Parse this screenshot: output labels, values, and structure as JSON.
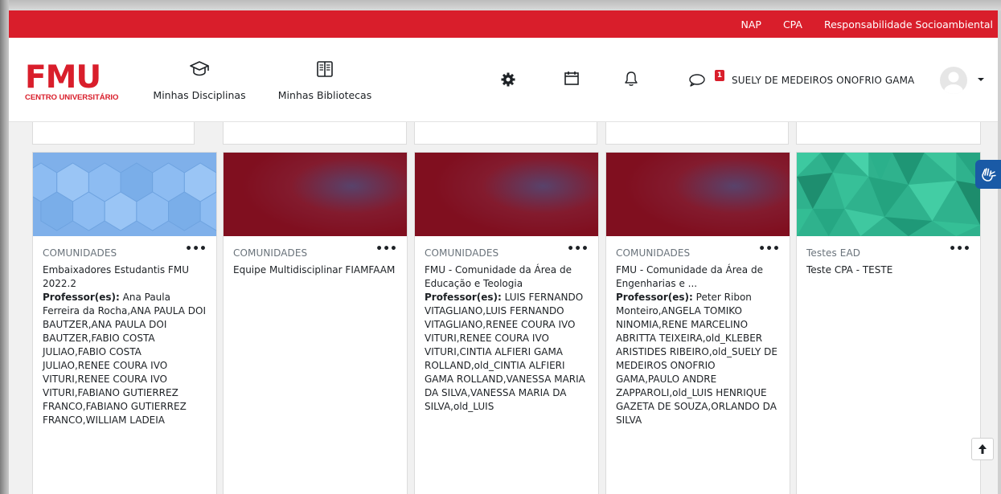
{
  "topbar": {
    "links": [
      "NAP",
      "CPA",
      "Responsabilidade Socioambiental"
    ]
  },
  "brand": {
    "logo_word": "FMU",
    "logo_sub": "CENTRO UNIVERSITÁRIO",
    "color": "#d91e2b"
  },
  "nav": {
    "disciplinas_label": "Minhas Disciplinas",
    "bibliotecas_label": "Minhas Bibliotecas",
    "icons": [
      "graduation-cap-icon",
      "book-open-icon",
      "gear-icon",
      "calendar-icon",
      "bell-icon",
      "chat-bubble-icon"
    ]
  },
  "user": {
    "name": "SUELY DE MEDEIROS ONOFRIO GAMA",
    "message_count": "1"
  },
  "cards": [
    {
      "category": "COMUNIDADES",
      "title": "Embaixadores Estudantis FMU 2022.2",
      "prof_label": "Professor(es):",
      "professors": "Ana Paula Ferreira da Rocha,ANA PAULA DOI BAUTZER,ANA PAULA DOI BAUTZER,FABIO COSTA JULIAO,FABIO COSTA JULIAO,RENEE COURA IVO VITURI,RENEE COURA IVO VITURI,FABIANO GUTIERREZ FRANCO,FABIANO GUTIERREZ FRANCO,WILLIAM LADEIA",
      "image": "hex-blue"
    },
    {
      "category": "COMUNIDADES",
      "title": "Equipe Multidisciplinar FIAMFAAM",
      "prof_label": "",
      "professors": "",
      "image": "red-blur"
    },
    {
      "category": "COMUNIDADES",
      "title": "FMU - Comunidade da Área de Educação e Teologia",
      "prof_label": "Professor(es):",
      "professors": "LUIS FERNANDO VITAGLIANO,LUIS FERNANDO VITAGLIANO,RENEE COURA IVO VITURI,RENEE COURA IVO VITURI,CINTIA ALFIERI GAMA ROLLAND,old_CINTIA ALFIERI GAMA ROLLAND,VANESSA MARIA DA SILVA,VANESSA MARIA DA SILVA,old_LUIS",
      "image": "red-blur"
    },
    {
      "category": "COMUNIDADES",
      "title": "FMU - Comunidade da Área de Engenharias e ...",
      "prof_label": "Professor(es):",
      "professors": "Peter Ribon Monteiro,ANGELA TOMIKO NINOMIA,RENE MARCELINO ABRITTA TEIXEIRA,old_KLEBER ARISTIDES RIBEIRO,old_SUELY DE MEDEIROS ONOFRIO GAMA,PAULO ANDRE ZAPPAROLI,old_LUIS HENRIQUE GAZETA DE SOUZA,ORLANDO DA SILVA",
      "image": "red-blur"
    },
    {
      "category": "Testes EAD",
      "title": "Teste CPA - TESTE",
      "prof_label": "",
      "professors": "",
      "image": "teal-geo"
    }
  ],
  "more_label": "•••"
}
